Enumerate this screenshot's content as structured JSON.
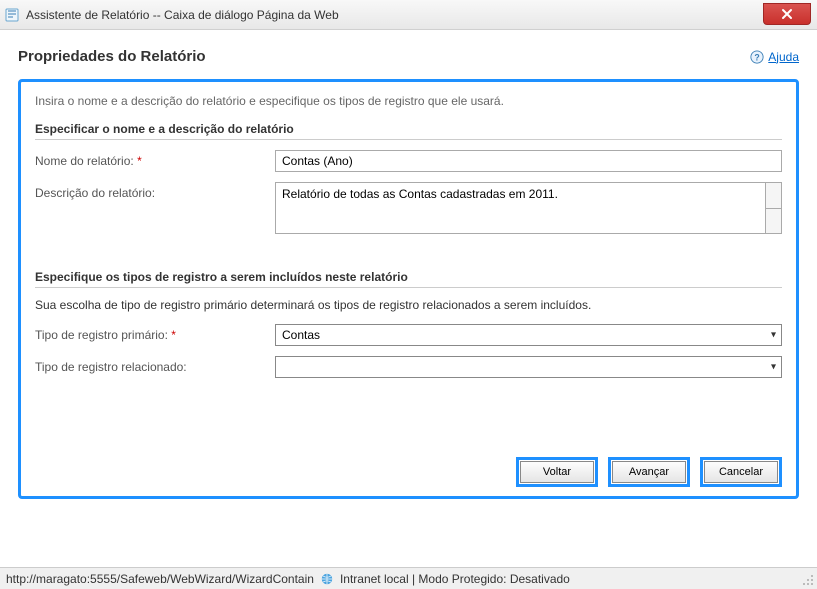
{
  "window": {
    "title": "Assistente de Relatório -- Caixa de diálogo Página da Web"
  },
  "page": {
    "heading": "Propriedades do Relatório",
    "help_label": "Ajuda",
    "intro": "Insira o nome e a descrição do relatório e especifique os tipos de registro que ele usará."
  },
  "section1": {
    "header": "Especificar o nome e a descrição do relatório",
    "name_label": "Nome do relatório:",
    "name_value": "Contas (Ano)",
    "desc_label": "Descrição do relatório:",
    "desc_value": "Relatório de todas as Contas cadastradas em 2011."
  },
  "section2": {
    "header": "Especifique os tipos de registro a serem incluídos neste relatório",
    "subtext": "Sua escolha de tipo de registro primário determinará os tipos de registro relacionados a serem incluídos.",
    "primary_label": "Tipo de registro primário:",
    "primary_value": "Contas",
    "related_label": "Tipo de registro relacionado:",
    "related_value": ""
  },
  "buttons": {
    "back": "Voltar",
    "next": "Avançar",
    "cancel": "Cancelar"
  },
  "statusbar": {
    "url": "http://maragato:5555/Safeweb/WebWizard/WizardContain",
    "zone": "Intranet local | Modo Protegido: Desativado"
  }
}
